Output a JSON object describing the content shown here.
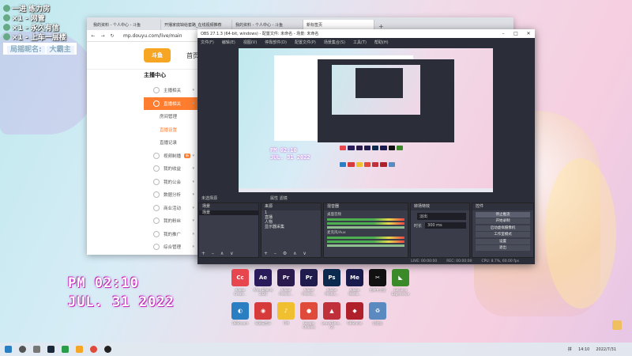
{
  "overlay": {
    "rows": [
      "一进 练力房",
      "×1 - 网管",
      "×1 - 永久有信",
      "×1 - 上车一层楼"
    ],
    "name_label": "局摇昵名:",
    "name_value": "大霸主"
  },
  "browser": {
    "tabs": [
      "我的资料 - 个人中心 - 斗鱼",
      "开播家底缺给套路_在线视频推荐",
      "我的资料 - 个人中心 - 斗鱼",
      "新标签页"
    ],
    "tab_new": "+",
    "url": "mp.douyu.com/live/main",
    "logo_text": "斗鱼",
    "home_text": "首页",
    "sidebar_title": "主播中心",
    "sidebar_items": [
      {
        "label": "主播相关",
        "type": "item"
      },
      {
        "label": "直播相关",
        "type": "active"
      },
      {
        "label": "房间管理",
        "type": "sub"
      },
      {
        "label": "直播设置",
        "type": "sub-current"
      },
      {
        "label": "直播记录",
        "type": "sub"
      },
      {
        "label": "视频制播",
        "type": "item",
        "badge": "新"
      },
      {
        "label": "我的收益",
        "type": "item"
      },
      {
        "label": "我的公会",
        "type": "item"
      },
      {
        "label": "数据分析",
        "type": "item"
      },
      {
        "label": "商业活动",
        "type": "item"
      },
      {
        "label": "我的粉丝",
        "type": "item"
      },
      {
        "label": "我的推广",
        "type": "item"
      },
      {
        "label": "综合管理",
        "type": "item"
      }
    ]
  },
  "obs": {
    "title": "OBS 27.1.3 (64-bit, windows) - 配置文件: 未命名 - 场景: 未命名",
    "menu": [
      "文件(F)",
      "编辑(E)",
      "视图(V)",
      "停靠部件(D)",
      "配置文件(P)",
      "场景集合(S)",
      "工具(T)",
      "帮助(H)"
    ],
    "scene_bar": "未选择源",
    "scene_bar_2": "属性    滤镜",
    "preview_time": [
      "PM 02:10",
      "JUL. 31 2022"
    ],
    "docks": {
      "scenes": {
        "title": "场景",
        "items": [
          "场景"
        ]
      },
      "sources": {
        "title": "来源",
        "items": [
          "1",
          "直播",
          "人物",
          "显示器采集"
        ]
      },
      "mixer": {
        "title": "混音器",
        "tracks": [
          "桌面音频",
          "麦克风/Aux"
        ]
      },
      "transitions": {
        "title": "转场特效",
        "type": "淡出",
        "duration_label": "时长",
        "duration": "300 ms"
      },
      "controls": {
        "title": "控件",
        "buttons": [
          "停止推流",
          "开始录制",
          "启动虚拟摄像机",
          "工作室模式",
          "设置",
          "退出"
        ]
      }
    },
    "status": [
      "LIVE: 00:00:00",
      "REC: 00:00:00",
      "CPU: 8.7%, 60.00 fps"
    ]
  },
  "desktop_clock": {
    "time": "PM 02:10",
    "date": "JUL. 31 2022"
  },
  "desktop_icons": [
    {
      "label": "Adobe\nCreati...",
      "glyph": "Cc",
      "color": "#e8464e"
    },
    {
      "label": "After Effects\n2020",
      "glyph": "Ae",
      "color": "#2a1b5a"
    },
    {
      "label": "Adobe\nPremie...",
      "glyph": "Pr",
      "color": "#2a1a4d"
    },
    {
      "label": "Adobe\nPremie...",
      "glyph": "Pr",
      "color": "#1f1b4d"
    },
    {
      "label": "Adobe\nPhotos...",
      "glyph": "Ps",
      "color": "#0b2a4d"
    },
    {
      "label": "Adobe\nMedia...",
      "glyph": "Me",
      "color": "#1a1b4d"
    },
    {
      "label": "剪映专业版",
      "glyph": "✂",
      "color": "#111111"
    },
    {
      "label": "GeForce\nExperience",
      "glyph": "◣",
      "color": "#3a8a2a"
    },
    {
      "label": "OBStream",
      "glyph": "◐",
      "color": "#2a7ec2"
    },
    {
      "label": "网易云音乐",
      "glyph": "◉",
      "color": "#d63a3a"
    },
    {
      "label": "TIM",
      "glyph": "♪",
      "color": "#f0c030"
    },
    {
      "label": "Google\nChrome",
      "glyph": "●",
      "color": "#e04a3a"
    },
    {
      "label": "LeaveTime...\n(2)",
      "glyph": "▲",
      "color": "#c0303a"
    },
    {
      "label": "OBStudio",
      "glyph": "◆",
      "color": "#b0202a"
    },
    {
      "label": "回收站",
      "glyph": "♻",
      "color": "#5a8ac0"
    }
  ],
  "taskbar": {
    "tray": [
      "拼",
      "14:10",
      "2022/7/31"
    ]
  }
}
